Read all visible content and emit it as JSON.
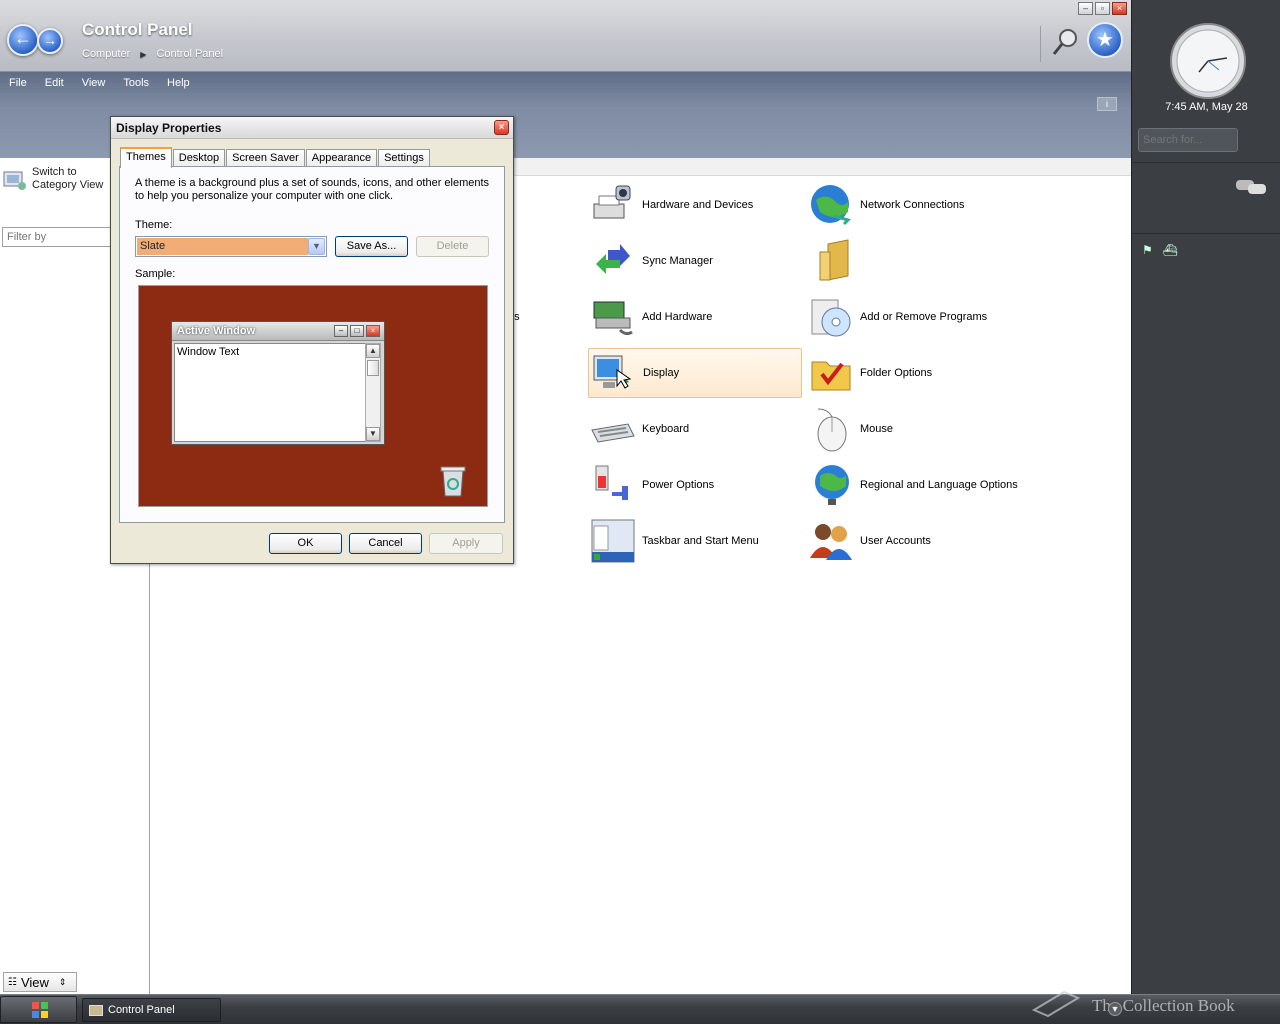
{
  "window": {
    "title": "Control Panel",
    "breadcrumb": [
      "Computer",
      "Control Panel"
    ],
    "menu": [
      "File",
      "Edit",
      "View",
      "Tools",
      "Help"
    ]
  },
  "left_pane": {
    "switch_label": "Switch to Category View",
    "filter_placeholder": "Filter by",
    "view_label": "View"
  },
  "applets": [
    {
      "label": "Hardware and Devices",
      "icon": "printer-camera-icon"
    },
    {
      "label": "Network Connections",
      "icon": "globe-network-icon"
    },
    {
      "label": "Sync Manager",
      "icon": "sync-arrows-icon"
    },
    {
      "label": "",
      "icon": "folder-icon"
    },
    {
      "label": "Add Hardware",
      "icon": "add-hardware-icon"
    },
    {
      "label": "Add or Remove Programs",
      "icon": "add-remove-programs-icon"
    },
    {
      "label": "Display",
      "icon": "display-icon"
    },
    {
      "label": "Folder Options",
      "icon": "folder-options-icon"
    },
    {
      "label": "Keyboard",
      "icon": "keyboard-icon"
    },
    {
      "label": "Mouse",
      "icon": "mouse-icon"
    },
    {
      "label": "Power Options",
      "icon": "power-options-icon"
    },
    {
      "label": "Regional and Language Options",
      "icon": "globe-regional-icon"
    },
    {
      "label": "Taskbar and Start Menu",
      "icon": "taskbar-start-icon"
    },
    {
      "label": "User Accounts",
      "icon": "user-accounts-icon"
    }
  ],
  "partial_text": "ns",
  "dialog": {
    "title": "Display Properties",
    "tabs": [
      "Themes",
      "Desktop",
      "Screen Saver",
      "Appearance",
      "Settings"
    ],
    "active_tab": "Themes",
    "description": "A theme is a background plus a set of sounds, icons, and other elements to help you personalize your computer with one click.",
    "theme_label": "Theme:",
    "theme_value": "Slate",
    "save_as": "Save As...",
    "delete": "Delete",
    "sample_label": "Sample:",
    "sample_window_title": "Active Window",
    "sample_window_text": "Window Text",
    "sample_bg_color": "#8d2a12",
    "ok": "OK",
    "cancel": "Cancel",
    "apply": "Apply"
  },
  "sidebar": {
    "clock_text": "7:45 AM, May 28",
    "search_placeholder": "Search for..."
  },
  "taskbar": {
    "task_label": "Control Panel",
    "watermark": "The Collection Book"
  }
}
